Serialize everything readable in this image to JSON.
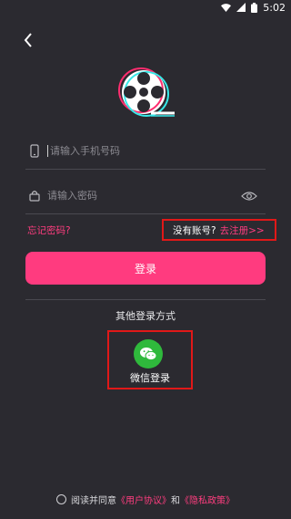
{
  "status_bar": {
    "time": "5:02"
  },
  "login": {
    "phone_placeholder": "请输入手机号码",
    "password_placeholder": "请输入密码",
    "forgot_label": "忘记密码?",
    "no_account_label": "没有账号?",
    "register_label": "去注册>>",
    "login_button": "登录",
    "other_methods_label": "其他登录方式",
    "wechat_label": "微信登录"
  },
  "agreement": {
    "prefix": "阅读并同意",
    "user_agreement": "《用户协议》",
    "and": "和",
    "privacy_policy": "《隐私政策》"
  },
  "colors": {
    "background": "#2b2a30",
    "accent": "#ff3b7f",
    "highlight_box": "#e01818",
    "wechat_green": "#2fb93c"
  }
}
